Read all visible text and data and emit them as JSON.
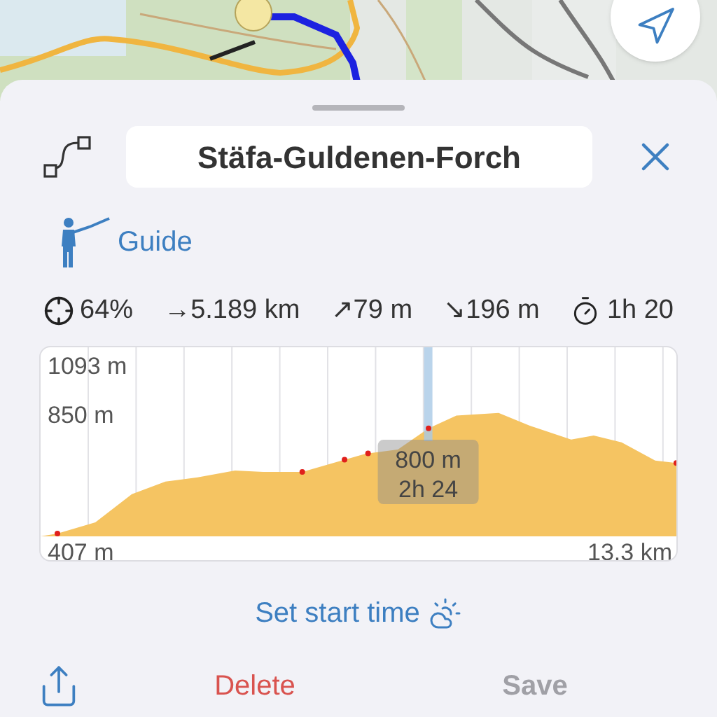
{
  "route": {
    "name": "Stäfa-Guldenen-Forch"
  },
  "guide": {
    "label": "Guide"
  },
  "stats": [
    {
      "kind": "accuracy",
      "text": "64%"
    },
    {
      "kind": "distance",
      "text": "→5.189 km"
    },
    {
      "kind": "ascent",
      "text": "↗79 m"
    },
    {
      "kind": "descent",
      "text": "↘196 m"
    },
    {
      "kind": "duration",
      "text": "1h 20"
    }
  ],
  "profile": {
    "labels": [
      {
        "kind": "max",
        "text": "1093 m"
      },
      {
        "kind": "mid",
        "text": "850 m"
      },
      {
        "kind": "min",
        "text": "407 m"
      },
      {
        "kind": "length",
        "text": "13.3 km"
      }
    ],
    "cursor": {
      "level": 0.607,
      "elevation": "800 m",
      "time": "2h 24"
    }
  },
  "start_time": {
    "label": "Set start time"
  },
  "actions": [
    {
      "kind": "share"
    },
    {
      "kind": "delete",
      "label": "Delete",
      "disabled": false
    },
    {
      "kind": "save",
      "label": "Save",
      "disabled": true
    }
  ]
}
